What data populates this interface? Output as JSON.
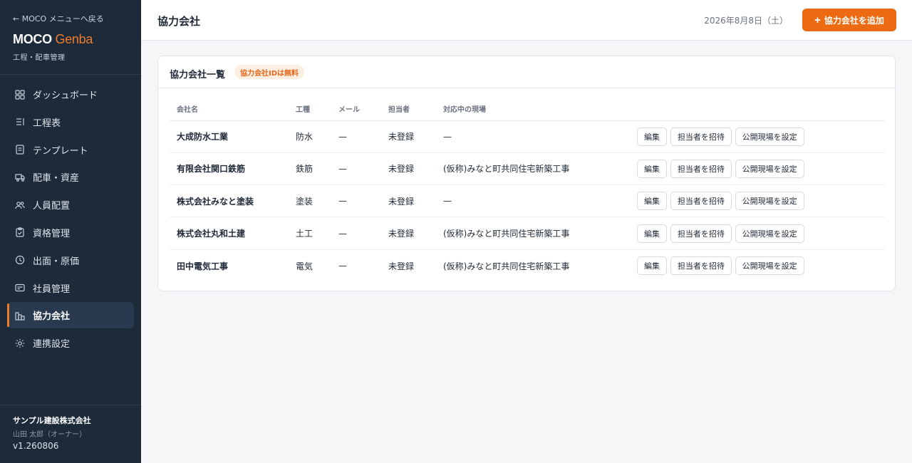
{
  "sidebar": {
    "back_link": "← MOCO メニューへ戻る",
    "brand_main": "MOCO",
    "brand_accent": "Genba",
    "brand_sub": "工程・配車管理",
    "items": [
      {
        "label": "ダッシュボード",
        "icon": "grid-icon"
      },
      {
        "label": "工程表",
        "icon": "list-icon"
      },
      {
        "label": "テンプレート",
        "icon": "document-icon"
      },
      {
        "label": "配車・資産",
        "icon": "truck-icon"
      },
      {
        "label": "人員配置",
        "icon": "users-icon"
      },
      {
        "label": "資格管理",
        "icon": "clipboard-icon"
      },
      {
        "label": "出面・原価",
        "icon": "clock-icon"
      },
      {
        "label": "社員管理",
        "icon": "id-card-icon"
      },
      {
        "label": "協力会社",
        "icon": "buildings-icon",
        "active": true
      },
      {
        "label": "連携設定",
        "icon": "sun-icon"
      }
    ],
    "company": "サンプル建設株式会社",
    "user": "山田 太郎（オーナー）",
    "version": "v1.260806"
  },
  "header": {
    "title": "協力会社",
    "date": "2026年8月8日（土）",
    "add_button": "協力会社を追加"
  },
  "card": {
    "title": "協力会社一覧",
    "badge": "協力会社IDは無料",
    "columns": [
      "会社名",
      "工種",
      "メール",
      "担当者",
      "対応中の現場"
    ],
    "actions": {
      "edit": "編集",
      "invite": "担当者を招待",
      "publish": "公開現場を設定"
    },
    "rows": [
      {
        "name": "大成防水工業",
        "trade": "防水",
        "email": "—",
        "contact": "未登録",
        "site": "—"
      },
      {
        "name": "有限会社関口鉄筋",
        "trade": "鉄筋",
        "email": "—",
        "contact": "未登録",
        "site": "(仮称)みなと町共同住宅新築工事"
      },
      {
        "name": "株式会社みなと塗装",
        "trade": "塗装",
        "email": "—",
        "contact": "未登録",
        "site": "—"
      },
      {
        "name": "株式会社丸和土建",
        "trade": "土工",
        "email": "—",
        "contact": "未登録",
        "site": "(仮称)みなと町共同住宅新築工事"
      },
      {
        "name": "田中電気工事",
        "trade": "電気",
        "email": "—",
        "contact": "未登録",
        "site": "(仮称)みなと町共同住宅新築工事"
      }
    ]
  },
  "colors": {
    "sidebar_bg": "#1c2a3a",
    "accent": "#ec6b12",
    "badge_bg": "#fdeee2"
  }
}
